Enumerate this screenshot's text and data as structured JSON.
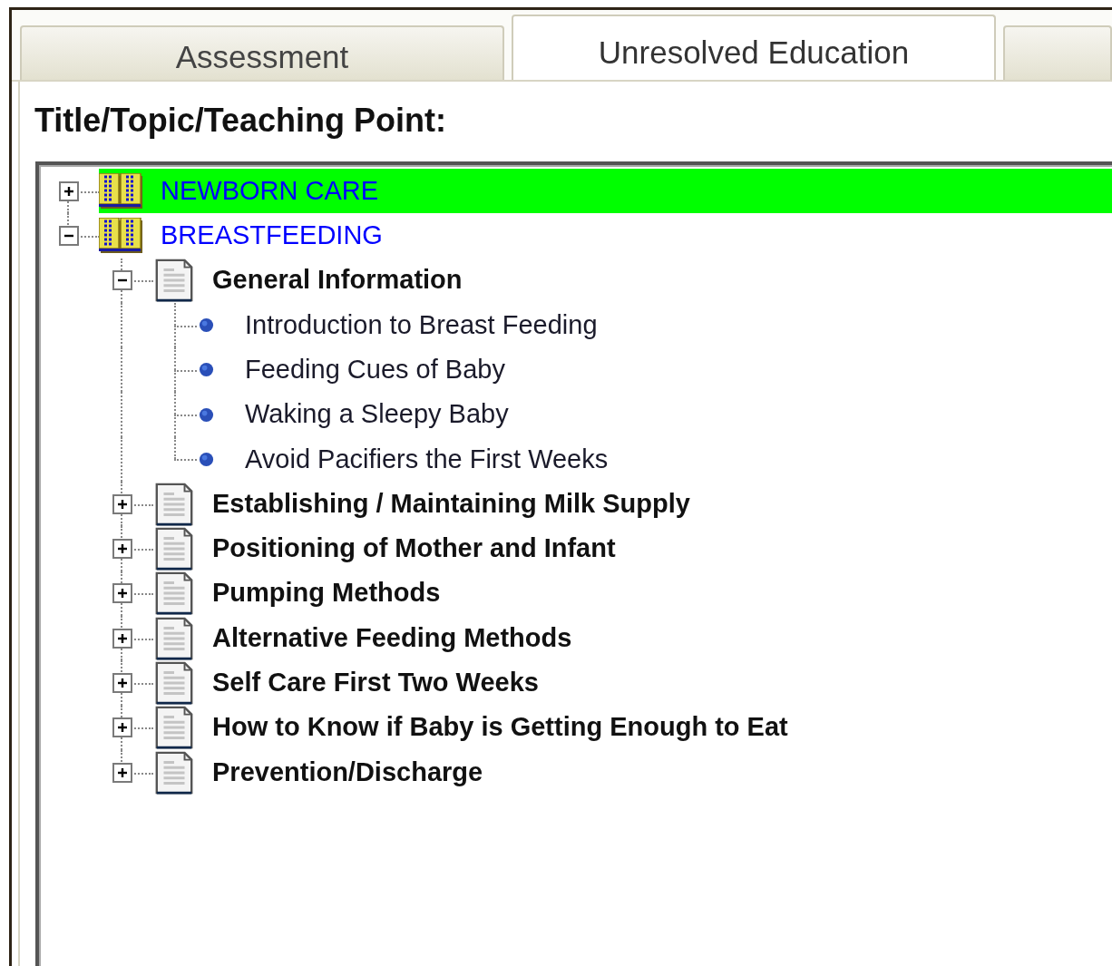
{
  "tabs": [
    {
      "label": "Assessment",
      "selected": false
    },
    {
      "label": "Unresolved Education",
      "selected": true
    }
  ],
  "field_label": "Title/Topic/Teaching Point:",
  "tree": [
    {
      "kind": "book",
      "label": "NEWBORN CARE",
      "expanded": false,
      "selected": true
    },
    {
      "kind": "book",
      "label": "BREASTFEEDING",
      "expanded": true,
      "selected": false,
      "children": [
        {
          "kind": "page",
          "label": "General Information",
          "expanded": true,
          "selected": false,
          "children": [
            {
              "kind": "point",
              "label": "Introduction to Breast Feeding",
              "selected": false
            },
            {
              "kind": "point",
              "label": "Feeding Cues of Baby",
              "selected": false
            },
            {
              "kind": "point",
              "label": "Waking a Sleepy Baby",
              "selected": false
            },
            {
              "kind": "point",
              "label": "Avoid Pacifiers the First Weeks",
              "selected": false
            }
          ]
        },
        {
          "kind": "page",
          "label": "Establishing / Maintaining Milk Supply",
          "expanded": false,
          "selected": false
        },
        {
          "kind": "page",
          "label": "Positioning of Mother and Infant",
          "expanded": false,
          "selected": false
        },
        {
          "kind": "page",
          "label": "Pumping Methods",
          "expanded": false,
          "selected": false
        },
        {
          "kind": "page",
          "label": "Alternative Feeding Methods",
          "expanded": false,
          "selected": false
        },
        {
          "kind": "page",
          "label": "Self Care First Two Weeks",
          "expanded": false,
          "selected": false
        },
        {
          "kind": "page",
          "label": "How to Know if Baby is Getting Enough to Eat",
          "expanded": false,
          "selected": false
        },
        {
          "kind": "page",
          "label": "Prevention/Discharge",
          "expanded": false,
          "selected": false
        }
      ]
    }
  ]
}
